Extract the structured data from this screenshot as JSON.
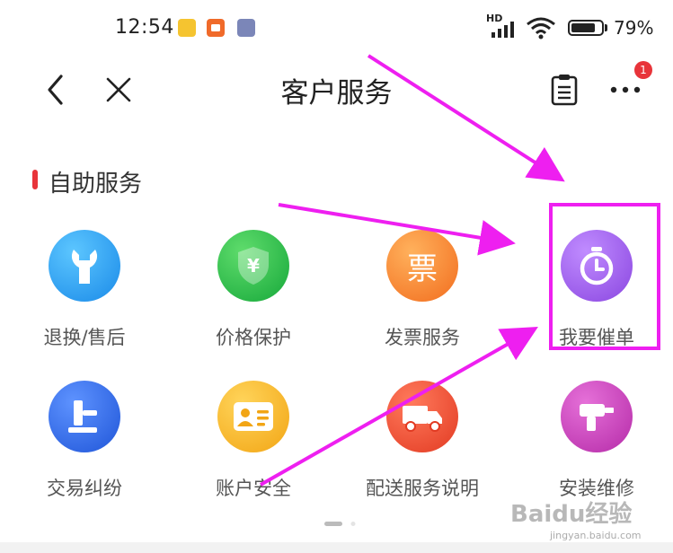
{
  "status_bar": {
    "time": "12:54",
    "network_label": "HD",
    "battery_percent": "79%",
    "battery_level": 0.79
  },
  "nav": {
    "title": "客户服务",
    "badge_count": "1",
    "back_icon": "chevron-left-icon",
    "close_icon": "close-icon",
    "clipboard_icon": "clipboard-icon",
    "more_icon": "more-dots-icon"
  },
  "section": {
    "title": "自助服务"
  },
  "services": [
    {
      "label": "退换/售后",
      "icon": "wrench-icon",
      "color": "#1fa3f2"
    },
    {
      "label": "价格保护",
      "icon": "shield-yen-icon",
      "color": "#2fc24a"
    },
    {
      "label": "发票服务",
      "icon": "invoice-icon",
      "color": "#f6862f",
      "glyph": "票"
    },
    {
      "label": "我要催单",
      "icon": "timer-icon",
      "color": "#9b5ee8"
    },
    {
      "label": "交易纠纷",
      "icon": "gavel-icon",
      "color": "#2c66e2"
    },
    {
      "label": "账户安全",
      "icon": "id-card-icon",
      "color": "#f6b628"
    },
    {
      "label": "配送服务说明",
      "icon": "truck-icon",
      "color": "#ee4a33"
    },
    {
      "label": "安装维修",
      "icon": "drill-icon",
      "color": "#c940b8"
    }
  ],
  "pager": {
    "count": 2,
    "active": 1
  },
  "watermark": {
    "text": "Baidu经验",
    "url": "jingyan.baidu.com"
  },
  "annotation_color": "#ee1ff0"
}
